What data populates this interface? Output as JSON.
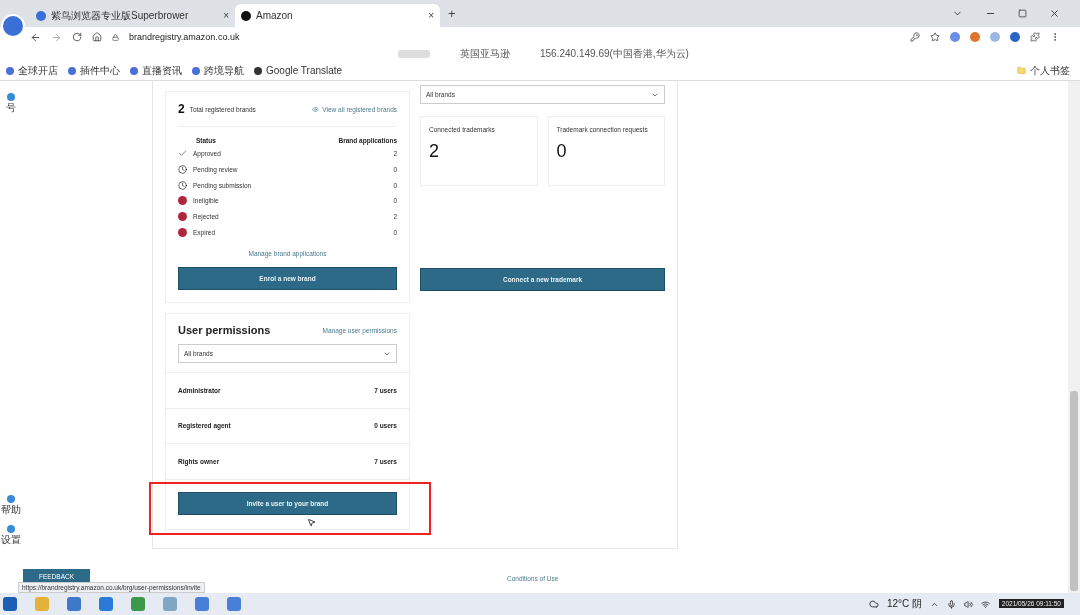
{
  "browser": {
    "tabs": [
      {
        "title": "紫鸟浏览器专业版Superbrower",
        "selected": false,
        "close": "×"
      },
      {
        "title": "Amazon",
        "selected": true,
        "close": "×"
      }
    ],
    "new_tab": "+",
    "url": "brandregistry.amazon.co.uk",
    "site": "英国亚马逊",
    "ip": "156.240.149.69(中国香港,华为云)",
    "bookmarks": [
      "全球开店",
      "插件中心",
      "直播资讯",
      "跨境导航",
      "Google Translate"
    ],
    "personal_bookmarks": "个人书签"
  },
  "sidebar": {
    "items": [
      "号",
      "帮助",
      "设置"
    ]
  },
  "brands_card": {
    "count": "2",
    "label": "Total registered brands",
    "link": "View all registered brands",
    "status_heading": "Status",
    "apps_heading": "Brand applications",
    "statuses": [
      {
        "kind": "check",
        "label": "Approved",
        "count": "2"
      },
      {
        "kind": "clock",
        "label": "Pending review",
        "count": "0"
      },
      {
        "kind": "clock",
        "label": "Pending submission",
        "count": "0"
      },
      {
        "kind": "alert",
        "label": "Ineligible",
        "count": "0"
      },
      {
        "kind": "alert",
        "label": "Rejected",
        "count": "2"
      },
      {
        "kind": "alert",
        "label": "Expired",
        "count": "0"
      }
    ],
    "manage_link": "Manage brand applications",
    "button": "Enrol a new brand"
  },
  "trademark_card": {
    "select": "All brands",
    "tiles": [
      {
        "label": "Connected trademarks",
        "value": "2"
      },
      {
        "label": "Trademark connection requests",
        "value": "0"
      }
    ],
    "button": "Connect a new trademark"
  },
  "permissions_card": {
    "title": "User permissions",
    "link": "Manage user permissions",
    "select": "All brands",
    "roles": [
      {
        "name": "Administrator",
        "count": "7 users"
      },
      {
        "name": "Registered agent",
        "count": "0 users"
      },
      {
        "name": "Rights owner",
        "count": "7 users"
      }
    ],
    "button": "Invite a user to your brand"
  },
  "feedback": "FEEDBACK",
  "status_url": "https://brandregistry.amazon.co.uk/brg/user-permissions/invite",
  "footer_link": "Conditions of Use",
  "taskbar": {
    "weather": "12°C 阴",
    "clock": "2021/05/26 09:11:50"
  }
}
